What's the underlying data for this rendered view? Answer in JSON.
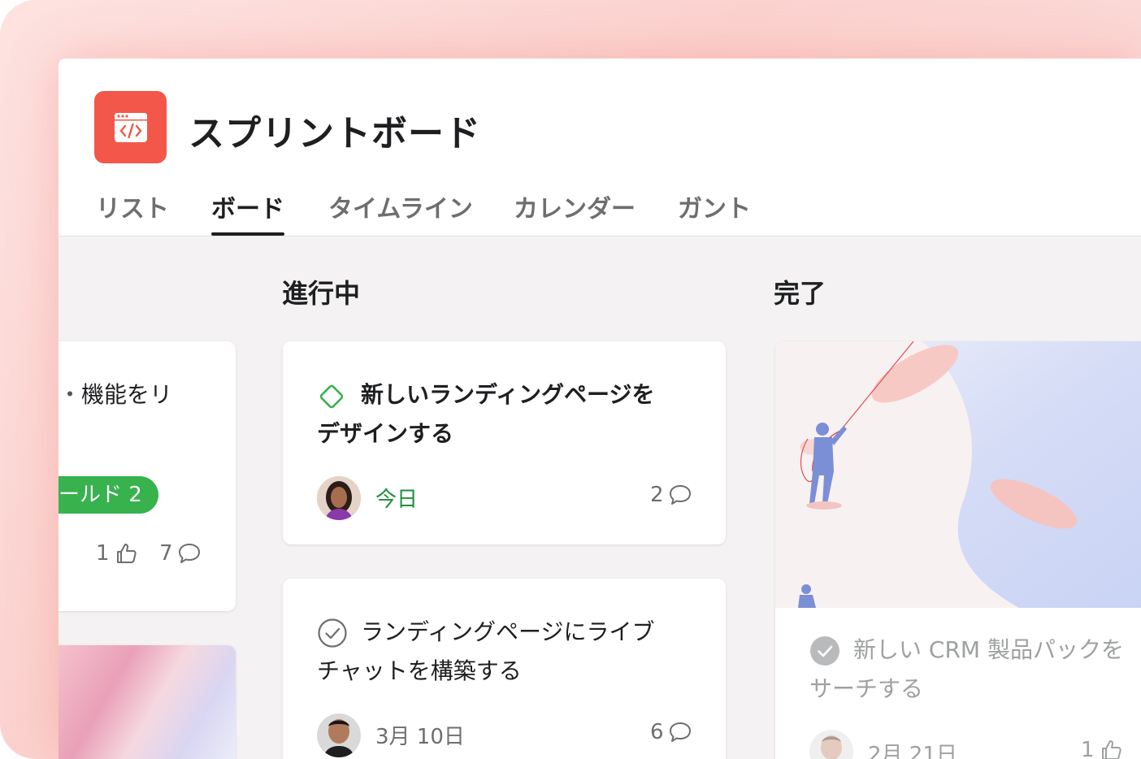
{
  "app": {
    "title": "スプリントボード",
    "accent_color": "#f3574a",
    "icon": "code-window-icon"
  },
  "tabs": [
    {
      "label": "リスト",
      "active": false
    },
    {
      "label": "ボード",
      "active": true
    },
    {
      "label": "タイムライン",
      "active": false
    },
    {
      "label": "カレンダー",
      "active": false
    },
    {
      "label": "ガント",
      "active": false
    }
  ],
  "columns": {
    "left": {
      "card": {
        "title_partial": "機能をリ",
        "tag": "ールド 2",
        "likes": "1",
        "comments": "7"
      }
    },
    "in_progress": {
      "title": "進行中",
      "cards": [
        {
          "title": "新しいランディングページをデザインする",
          "title_line1": "新しいランディングページを",
          "title_line2": "デザインする",
          "status": "incomplete",
          "due": "今日",
          "due_color": "#1f8f3a",
          "comments": "2"
        },
        {
          "title_line1": "ランディングページにライブ",
          "title_line2": "チャットを構築する",
          "status": "complete-outline",
          "due": "3月 10日",
          "comments": "6"
        }
      ]
    },
    "done": {
      "title": "完了",
      "card": {
        "title_line1": "新しい CRM 製品パックを",
        "title_line2": "サーチする",
        "due": "2月 21日",
        "likes": "1"
      }
    }
  }
}
